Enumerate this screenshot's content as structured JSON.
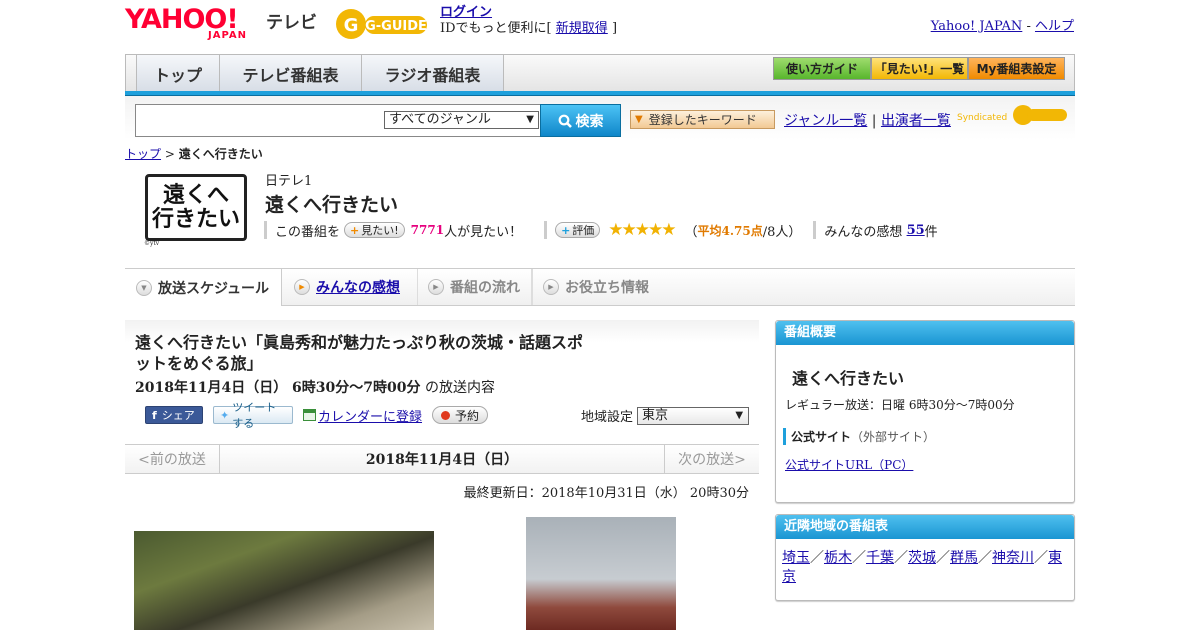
{
  "header": {
    "yahoo_logo": "YAHOO!",
    "yahoo_logo_sub": "JAPAN",
    "tv_label": "テレビ",
    "gguide_logo": "G-GUIDE",
    "login": "ログイン",
    "login_note_prefix": "IDでもっと便利に[",
    "register": "新規取得",
    "login_note_suffix": "]",
    "yahoo_japan_link": "Yahoo! JAPAN",
    "dash": " - ",
    "help_link": "ヘルプ"
  },
  "nav": {
    "tabs": [
      "トップ",
      "テレビ番組表",
      "ラジオ番組表"
    ],
    "buttons": [
      "使い方ガイド",
      "「見たい!」一覧",
      "My番組表設定"
    ]
  },
  "search": {
    "genre_selected": "すべてのジャンル",
    "search_button": "検索",
    "keyword_button": "登録したキーワード",
    "genre_list_link": "ジャンル一覧",
    "divider": "|",
    "performer_link": "出演者一覧",
    "syndicated": "Syndicated"
  },
  "breadcrumb": {
    "home": "トップ",
    "sep": " > ",
    "current": "遠くへ行きたい"
  },
  "program": {
    "logo_line1": "遠くへ",
    "logo_line2": "行きたい",
    "logo_credit": "©ytv",
    "channel": "日テレ1",
    "title": "遠くへ行きたい",
    "want_prefix": "この番組を",
    "want_button": "見たい!",
    "want_count": "7771",
    "want_suffix": "人が見たい！",
    "rate_button": "評価",
    "stars": "★★★★★",
    "rating_open": "（",
    "rating_avg": "平均4.75点",
    "rating_count": "/8人）",
    "review_prefix": "みんなの感想",
    "review_count": "55",
    "review_suffix": "件"
  },
  "program_tabs": [
    "放送スケジュール",
    "みんなの感想",
    "番組の流れ",
    "お役立ち情報"
  ],
  "episode": {
    "title": "遠くへ行きたい「眞島秀和が魅力たっぷり秋の茨城・話題スポットをめぐる旅」",
    "date_time": "2018年11月4日（日） 6時30分～7時00分",
    "date_suffix": "の放送内容",
    "share": "シェア",
    "tweet": "ツイートする",
    "calendar": "カレンダーに登録",
    "reserve": "予約",
    "region_label": "地域設定",
    "region_value": "東京",
    "prev": "<前の放送",
    "pager_date": "2018年11月4日（日）",
    "next": "次の放送>",
    "updated": "最終更新日：2018年10月31日（水） 20時30分"
  },
  "sidebar": {
    "overview_header": "番組概要",
    "overview_title": "遠くへ行きたい",
    "regular": "レギュラー放送：日曜 6時30分～7時00分",
    "official_label": "公式サイト",
    "official_note": "（外部サイト）",
    "official_url": "公式サイトURL（PC）",
    "nearby_header": "近隣地域の番組表",
    "nearby": [
      "埼玉",
      "栃木",
      "千葉",
      "茨城",
      "群馬",
      "神奈川",
      "東京"
    ],
    "nearby_sep": "／"
  },
  "colors": {
    "accent_blue": "#1ea0dc",
    "yahoo_red": "#ff0033",
    "want_count_pink": "#e6007e",
    "rating_orange": "#e07a00"
  }
}
